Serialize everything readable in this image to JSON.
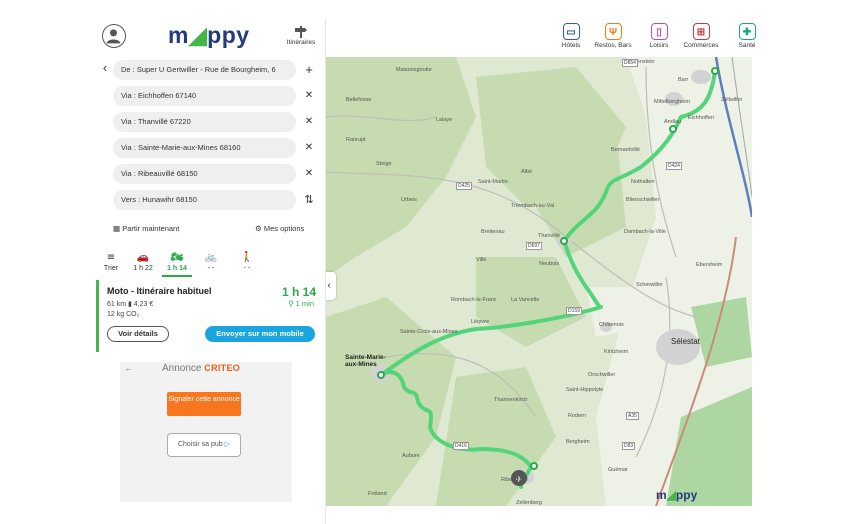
{
  "header": {
    "logo_text": "mappy",
    "itineraries_label": "Itinéraires"
  },
  "route": {
    "from": "De : Super U Gertwiller - Rue de Bourgheim, 6",
    "vias": [
      "Via : Eichhoffen 67140",
      "Via : Thanvillé 67220",
      "Via : Sainte-Marie-aux-Mines 68160",
      "Via : Ribeauvillé 68150"
    ],
    "to": "Vers : Hunawihr 68150",
    "depart_label": "Partir maintenant",
    "options_label": "Mes options"
  },
  "modes": [
    {
      "name": "sort",
      "label": "Trier",
      "icon": "sort-icon"
    },
    {
      "name": "car",
      "label": "1 h 22",
      "icon": "car-icon"
    },
    {
      "name": "moto",
      "label": "1 h 14",
      "icon": "motorcycle-icon",
      "active": true
    },
    {
      "name": "bike",
      "label": "- -",
      "icon": "bicycle-icon"
    },
    {
      "name": "walk",
      "label": "- -",
      "icon": "walk-icon"
    }
  ],
  "result": {
    "title": "Moto - Itinéraire habituel",
    "duration": "1 h 14",
    "distance_cost": "61 km  ▮ 4,23 €",
    "co2": "12 kg CO₂",
    "delay": "1 min",
    "details_label": "Voir détails",
    "send_label": "Envoyer sur mon mobile"
  },
  "ad": {
    "label": "Annonce",
    "brand": "CRITEO",
    "report_label": "Signaler cette annonce",
    "choose_label": "Choisir sa pub"
  },
  "categories": [
    {
      "label": "Hôtels",
      "icon": "hotel-icon",
      "color": "#2b5fb0"
    },
    {
      "label": "Restos, Bars",
      "icon": "restaurant-icon",
      "color": "#f07a1b"
    },
    {
      "label": "Loisirs",
      "icon": "leisure-icon",
      "color": "#c44ab0"
    },
    {
      "label": "Commerces",
      "icon": "shopping-icon",
      "color": "#d2343b"
    },
    {
      "label": "Santé",
      "icon": "health-icon",
      "color": "#1aa58a"
    }
  ],
  "map": {
    "places": [
      "Heiligenstein",
      "Barr",
      "Andlau",
      "Mittelbergheim",
      "Zellwiller",
      "Bernardvillé",
      "Eichhoffen",
      "Nothalten",
      "Blienschwiller",
      "Dambach-la-Ville",
      "Triembach-au-Val",
      "Thanvillé",
      "Villé",
      "Breitenau",
      "Saint-Martin",
      "Albé",
      "Neubois",
      "Sélestat",
      "Châtenois",
      "Kintzheim",
      "Sainte-Marie-aux-Mines",
      "Lièpvre",
      "Rombach-le-Franc",
      "La Vancelle",
      "Sainte-Croix-aux-Mines",
      "Orschwiller",
      "Saint-Hippolyte",
      "Rodern",
      "Thannenkirch",
      "Bergheim",
      "Ribeauvillé",
      "Aubure",
      "Fréland",
      "Guémar",
      "Zellenberg",
      "Urbeis",
      "Maisonsgoutte",
      "Bellefosse",
      "Lalaye",
      "Ranrupt",
      "Steige",
      "Ebersheim",
      "Scherwiller"
    ],
    "roads": [
      "D854",
      "D425",
      "D697",
      "D159",
      "D424",
      "D416",
      "A35",
      "D83"
    ],
    "brand": "mappy"
  }
}
